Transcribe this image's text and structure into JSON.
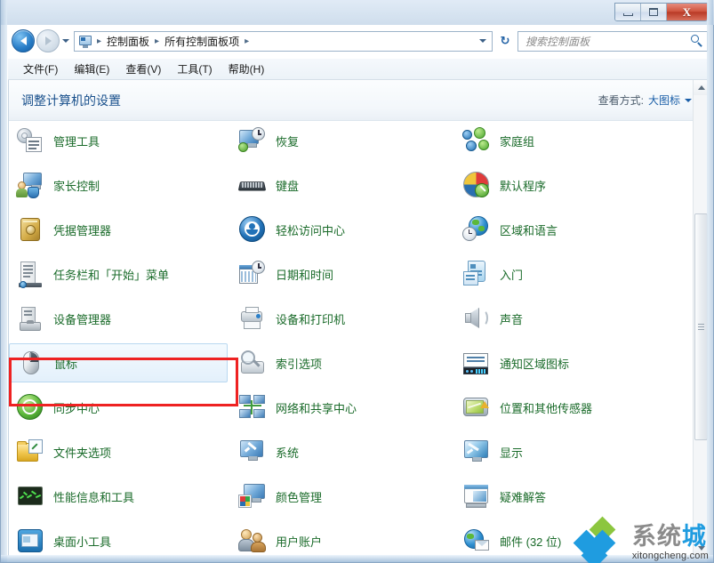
{
  "window": {
    "titlebar_buttons": [
      {
        "name": "minimize",
        "glyph": "—"
      },
      {
        "name": "maximize",
        "glyph": "❐"
      },
      {
        "name": "close",
        "glyph": "X"
      }
    ]
  },
  "navigation": {
    "back_tooltip": "后退",
    "forward_tooltip": "前进",
    "breadcrumbs": [
      "控制面板",
      "所有控制面板项"
    ],
    "separator": "▸",
    "refresh_glyph": "↻"
  },
  "search": {
    "placeholder": "搜索控制面板",
    "value": ""
  },
  "menubar": {
    "items": [
      "文件(F)",
      "编辑(E)",
      "查看(V)",
      "工具(T)",
      "帮助(H)"
    ]
  },
  "page": {
    "title": "调整计算机的设置",
    "view_label": "查看方式:",
    "view_value": "大图标"
  },
  "items": [
    {
      "label": "管理工具",
      "icon": "admin-tools-icon",
      "col": 0,
      "row": 0,
      "selected": false
    },
    {
      "label": "家长控制",
      "icon": "parental-controls-icon",
      "col": 0,
      "row": 1,
      "selected": false
    },
    {
      "label": "凭据管理器",
      "icon": "credential-manager-icon",
      "col": 0,
      "row": 2,
      "selected": false
    },
    {
      "label": "任务栏和「开始」菜单",
      "icon": "taskbar-start-menu-icon",
      "col": 0,
      "row": 3,
      "selected": false
    },
    {
      "label": "设备管理器",
      "icon": "device-manager-icon",
      "col": 0,
      "row": 4,
      "selected": false
    },
    {
      "label": "鼠标",
      "icon": "mouse-icon",
      "col": 0,
      "row": 5,
      "selected": true
    },
    {
      "label": "同步中心",
      "icon": "sync-center-icon",
      "col": 0,
      "row": 6,
      "selected": false
    },
    {
      "label": "文件夹选项",
      "icon": "folder-options-icon",
      "col": 0,
      "row": 7,
      "selected": false
    },
    {
      "label": "性能信息和工具",
      "icon": "performance-info-icon",
      "col": 0,
      "row": 8,
      "selected": false
    },
    {
      "label": "桌面小工具",
      "icon": "desktop-gadgets-icon",
      "col": 0,
      "row": 9,
      "selected": false
    },
    {
      "label": "恢复",
      "icon": "recovery-icon",
      "col": 1,
      "row": 0,
      "selected": false
    },
    {
      "label": "键盘",
      "icon": "keyboard-icon",
      "col": 1,
      "row": 1,
      "selected": false
    },
    {
      "label": "轻松访问中心",
      "icon": "ease-of-access-icon",
      "col": 1,
      "row": 2,
      "selected": false
    },
    {
      "label": "日期和时间",
      "icon": "date-time-icon",
      "col": 1,
      "row": 3,
      "selected": false
    },
    {
      "label": "设备和打印机",
      "icon": "devices-printers-icon",
      "col": 1,
      "row": 4,
      "selected": false
    },
    {
      "label": "索引选项",
      "icon": "indexing-options-icon",
      "col": 1,
      "row": 5,
      "selected": false
    },
    {
      "label": "网络和共享中心",
      "icon": "network-sharing-icon",
      "col": 1,
      "row": 6,
      "selected": false
    },
    {
      "label": "系统",
      "icon": "system-icon",
      "col": 1,
      "row": 7,
      "selected": false
    },
    {
      "label": "颜色管理",
      "icon": "color-management-icon",
      "col": 1,
      "row": 8,
      "selected": false
    },
    {
      "label": "用户账户",
      "icon": "user-accounts-icon",
      "col": 1,
      "row": 9,
      "selected": false
    },
    {
      "label": "家庭组",
      "icon": "homegroup-icon",
      "col": 2,
      "row": 0,
      "selected": false
    },
    {
      "label": "默认程序",
      "icon": "default-programs-icon",
      "col": 2,
      "row": 1,
      "selected": false
    },
    {
      "label": "区域和语言",
      "icon": "region-language-icon",
      "col": 2,
      "row": 2,
      "selected": false
    },
    {
      "label": "入门",
      "icon": "getting-started-icon",
      "col": 2,
      "row": 3,
      "selected": false
    },
    {
      "label": "声音",
      "icon": "sound-icon",
      "col": 2,
      "row": 4,
      "selected": false
    },
    {
      "label": "通知区域图标",
      "icon": "notification-area-icon",
      "col": 2,
      "row": 5,
      "selected": false
    },
    {
      "label": "位置和其他传感器",
      "icon": "location-sensors-icon",
      "col": 2,
      "row": 6,
      "selected": false
    },
    {
      "label": "显示",
      "icon": "display-icon",
      "col": 2,
      "row": 7,
      "selected": false
    },
    {
      "label": "疑难解答",
      "icon": "troubleshooting-icon",
      "col": 2,
      "row": 8,
      "selected": false
    },
    {
      "label": "邮件 (32 位)",
      "icon": "mail-icon",
      "col": 2,
      "row": 9,
      "selected": false
    }
  ],
  "annotation": {
    "target_label": "鼠标",
    "color": "#ee2222"
  },
  "watermark": {
    "cn_gray": "系统",
    "cn_blue": "城",
    "url": "xitongcheng.com"
  },
  "colors": {
    "item_label": "#1a6b2a",
    "page_title": "#19508c",
    "link": "#1b5fa8",
    "annotation": "#ee2222",
    "selection_bg": "#e3f0fb"
  }
}
